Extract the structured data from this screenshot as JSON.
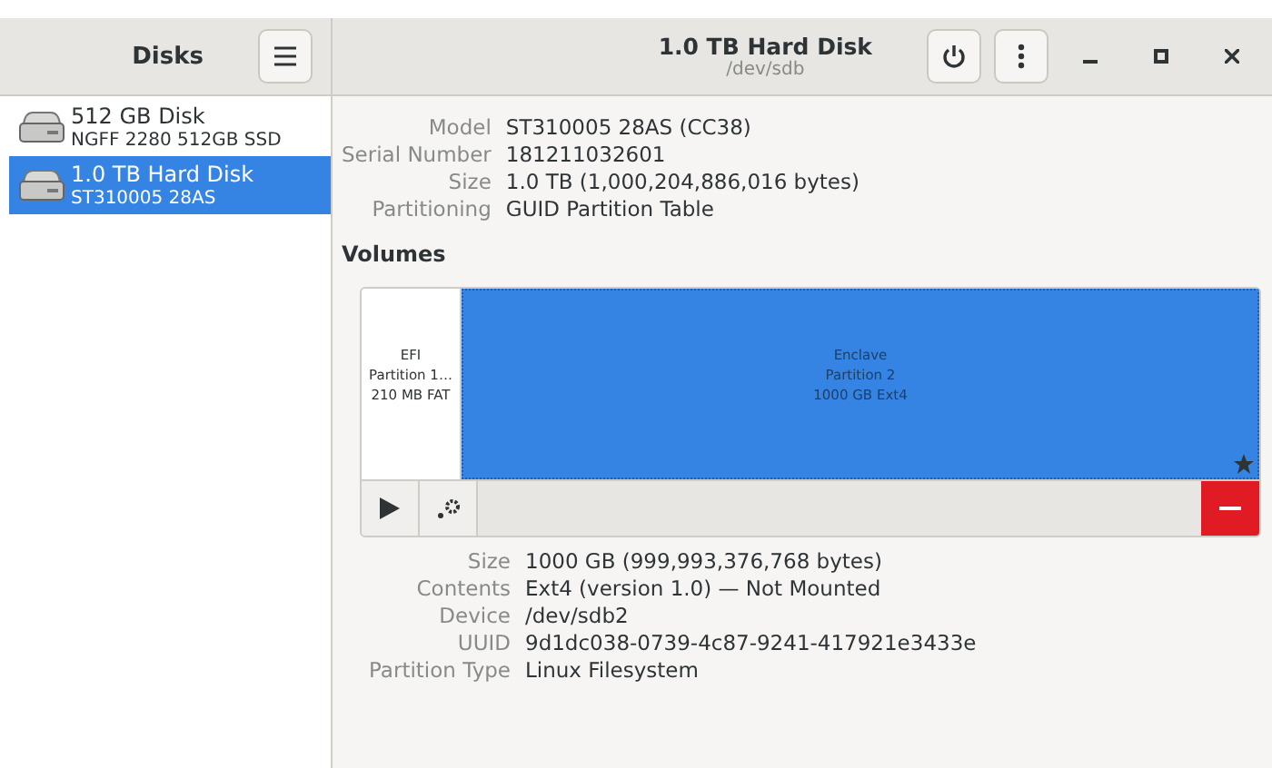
{
  "sidebar": {
    "title": "Disks",
    "items": [
      {
        "name": "512 GB Disk",
        "detail": "NGFF 2280 512GB SSD",
        "selected": false
      },
      {
        "name": "1.0 TB Hard Disk",
        "detail": "ST310005 28AS",
        "selected": true
      }
    ]
  },
  "header": {
    "title": "1.0 TB Hard Disk",
    "subtitle": "/dev/sdb"
  },
  "disk_info": [
    {
      "label": "Model",
      "value": "ST310005 28AS (CC38)"
    },
    {
      "label": "Serial Number",
      "value": "181211032601"
    },
    {
      "label": "Size",
      "value": "1.0 TB (1,000,204,886,016 bytes)"
    },
    {
      "label": "Partitioning",
      "value": "GUID Partition Table"
    }
  ],
  "volumes": {
    "title": "Volumes",
    "partitions": [
      {
        "lines": [
          "EFI",
          "Partition 1…",
          "210 MB FAT"
        ],
        "selected": false,
        "starred": false
      },
      {
        "lines": [
          "Enclave",
          "Partition 2",
          "1000 GB Ext4"
        ],
        "selected": true,
        "starred": true
      }
    ]
  },
  "volume_info": [
    {
      "label": "Size",
      "value": "1000 GB (999,993,376,768 bytes)"
    },
    {
      "label": "Contents",
      "value": "Ext4 (version 1.0) — Not Mounted"
    },
    {
      "label": "Device",
      "value": "/dev/sdb2"
    },
    {
      "label": "UUID",
      "value": "9d1dc038-0739-4c87-9241-417921e3433e"
    },
    {
      "label": "Partition Type",
      "value": "Linux Filesystem"
    }
  ]
}
